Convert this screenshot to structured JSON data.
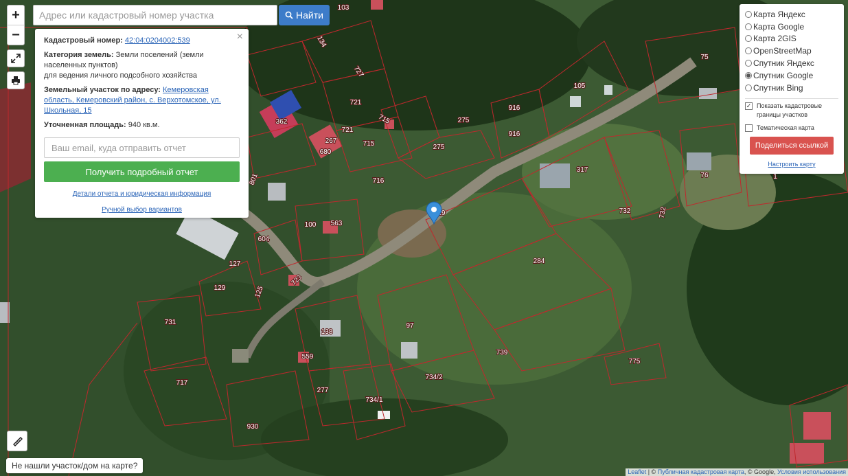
{
  "search": {
    "placeholder": "Адрес или кадастровый номер участка",
    "button_label": "Найти"
  },
  "controls": {
    "zoom_in": "+",
    "zoom_out": "−"
  },
  "info": {
    "cadastral_label": "Кадастровый номер:",
    "cadastral_value": "42:04:0204002:539",
    "category_label": "Категория земель:",
    "category_value": "Земли поселений (земли населенных пунктов)",
    "usage_value": "для ведения личного подсобного хозяйства",
    "address_label": "Земельный участок по адресу:",
    "address_value": "Кемеровская область, Кемеровский район, с. Верхотомское, ул. Школьная, 15",
    "area_label": "Уточненная площадь:",
    "area_value": "940 кв.м.",
    "email_placeholder": "Ваш email, куда отправить отчет",
    "report_button": "Получить подробный отчет",
    "details_link": "Детали отчета и юридическая информация",
    "manual_link": "Ручной выбор вариантов",
    "close": "×"
  },
  "layers": {
    "options": [
      {
        "label": "Карта Яндекс",
        "selected": false
      },
      {
        "label": "Карта Google",
        "selected": false
      },
      {
        "label": "Карта 2GIS",
        "selected": false
      },
      {
        "label": "OpenStreetMap",
        "selected": false
      },
      {
        "label": "Спутник Яндекс",
        "selected": false
      },
      {
        "label": "Спутник Google",
        "selected": true
      },
      {
        "label": "Спутник Bing",
        "selected": false
      }
    ],
    "show_borders": "Показать кадастровые границы участков",
    "show_borders_checked": true,
    "thematic": "Тематическая карта",
    "thematic_checked": false,
    "share_button": "Поделиться ссылкой",
    "setup_link": "Настроить карту"
  },
  "bottom": {
    "not_found": "Не нашли участок/дом на карте?",
    "attr_leaflet": "Leaflet",
    "attr_pkk": "Публичная кадастровая карта",
    "attr_google": "© Google",
    "attr_terms": "Условия использования"
  },
  "plot_numbers": [
    "103",
    "134",
    "727",
    "362",
    "721",
    "721",
    "715",
    "715",
    "275",
    "275",
    "916",
    "916",
    "105",
    "75",
    "317",
    "76",
    "1",
    "732",
    "732",
    "716",
    "801",
    "680",
    "267",
    "100",
    "563",
    "604",
    "127",
    "129",
    "125",
    "723",
    "284",
    "97",
    "138",
    "739",
    "775",
    "731",
    "559",
    "734/2",
    "717",
    "277",
    "734/1",
    "930",
    "19"
  ],
  "colors": {
    "accent": "#3d7cc9",
    "report_green": "#4caf50",
    "share_red": "#d9534f",
    "parcel_border": "#c0282d",
    "pin_blue": "#3a8fd9"
  }
}
